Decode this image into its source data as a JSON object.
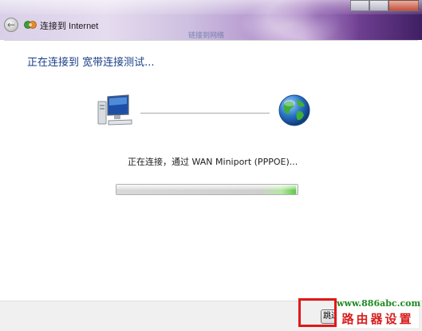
{
  "window": {
    "title": "连接到 Internet",
    "background_link": "链接到网络"
  },
  "main": {
    "heading": "正在连接到 宽带连接测试...",
    "status": "正在连接，通过 WAN Miniport (PPPOE)...",
    "progress_fraction": 0.99
  },
  "footer": {
    "skip_label": "跳过"
  },
  "watermark": {
    "site": "www.886abc.com",
    "text": "路由器设置"
  },
  "icons": {
    "back": "back-arrow-icon",
    "app": "network-connection-icon",
    "computer": "computer-icon",
    "globe": "globe-icon"
  },
  "colors": {
    "heading": "#1b3f88",
    "progress_green": "#5fc94a",
    "highlight_red": "#e01818"
  }
}
